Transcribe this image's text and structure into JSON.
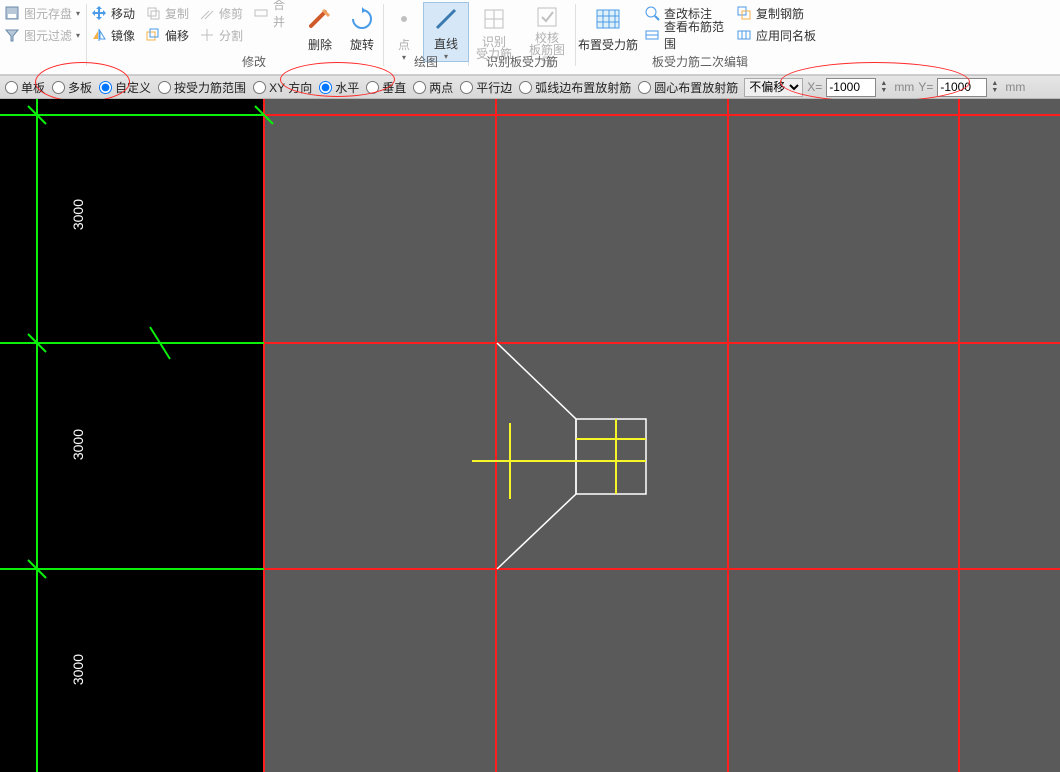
{
  "ribbon": {
    "left_stack": {
      "save": "图元存盘",
      "filter": "图元过滤"
    },
    "modify_group": {
      "label": "修改",
      "move": "移动",
      "mirror": "镜像",
      "copy": "复制",
      "offset": "偏移",
      "trim": "修剪",
      "merge": "合并",
      "split": "分割",
      "delete": "删除",
      "rotate": "旋转"
    },
    "draw_group": {
      "label": "绘图",
      "point": "点",
      "line": "直线"
    },
    "recognize_group": {
      "label": "识别板受力筋",
      "rec_rebar": "识别\n受力筋",
      "check_elem": "校核\n板筋图元"
    },
    "edit_group": {
      "label": "板受力筋二次编辑",
      "layout": "布置受力筋",
      "check_annot": "查改标注",
      "view_range": "查看布筋范围",
      "copy_rebar": "复制钢筋",
      "apply_same": "应用同名板"
    }
  },
  "optbar": {
    "single": "单板",
    "multi": "多板",
    "custom": "自定义",
    "by_range": "按受力筋范围",
    "xy_dir": "XY 方向",
    "horiz": "水平",
    "vert": "垂直",
    "two_pt": "两点",
    "parallel": "平行边",
    "arc_ray": "弧线边布置放射筋",
    "circle_ray": "圆心布置放射筋",
    "offset_sel": "不偏移",
    "x_label": "X=",
    "x_value": "-1000",
    "mm1": "mm",
    "y_label": "Y=",
    "y_value": "-1000",
    "mm2": "mm"
  },
  "dims": {
    "r1": "3000",
    "r2": "3000",
    "r3": "3000"
  }
}
